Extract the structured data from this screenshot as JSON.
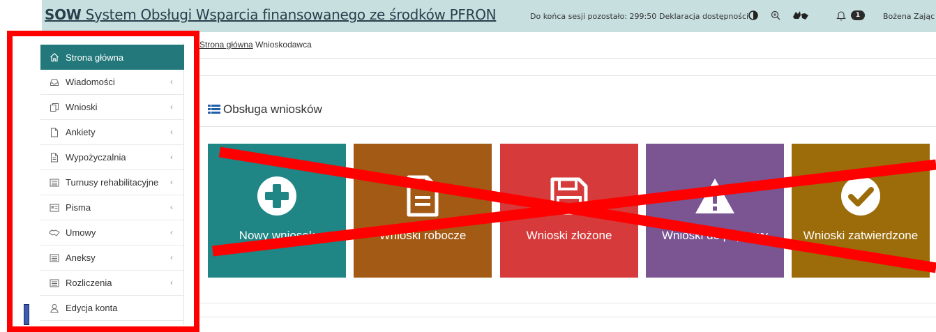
{
  "header": {
    "brand_abbr": "SOW",
    "brand_full": " System Obsługi Wsparcia finansowanego ze środków PFRON",
    "session_text": "Do końca sesji pozostało: 299:50",
    "accessibility_link": "Deklaracja dostępności",
    "notifications_count": "1",
    "user_name": "Bożena Zając",
    "bg_color": "#c8dfe0"
  },
  "sidebar": {
    "items": [
      {
        "label": "Strona główna",
        "icon": "home-icon",
        "active": true
      },
      {
        "label": "Wiadomości",
        "icon": "inbox-icon"
      },
      {
        "label": "Wnioski",
        "icon": "copy-icon"
      },
      {
        "label": "Ankiety",
        "icon": "file-icon"
      },
      {
        "label": "Wypożyczalnia",
        "icon": "document-icon"
      },
      {
        "label": "Turnusy rehabilitacyjne",
        "icon": "list-icon"
      },
      {
        "label": "Pisma",
        "icon": "card-icon"
      },
      {
        "label": "Umowy",
        "icon": "handshake-icon"
      },
      {
        "label": "Aneksy",
        "icon": "list-icon"
      },
      {
        "label": "Rozliczenia",
        "icon": "list-icon"
      },
      {
        "label": "Edycja konta",
        "icon": "user-icon"
      }
    ],
    "chevron": "‹",
    "active_color": "#23787b"
  },
  "breadcrumb": {
    "link": "Strona główna",
    "current": "Wnioskodawca"
  },
  "main": {
    "section_title": "Obsługa wniosków",
    "tiles": [
      {
        "label": "Nowy wniosek",
        "icon": "plus-circle-icon",
        "color": "#1f8585"
      },
      {
        "label": "Wnioski robocze",
        "icon": "document-icon",
        "color": "#a35a14"
      },
      {
        "label": "Wnioski złożone",
        "icon": "floppy-disk-icon",
        "color": "#d63a3a"
      },
      {
        "label": "Wnioski do poprawy",
        "icon": "warning-icon",
        "color": "#7a5592"
      },
      {
        "label": "Wnioski zatwierdzone",
        "icon": "check-circle-icon",
        "color": "#9c6c0a"
      }
    ]
  },
  "annotation": {
    "color": "#ff0000"
  }
}
